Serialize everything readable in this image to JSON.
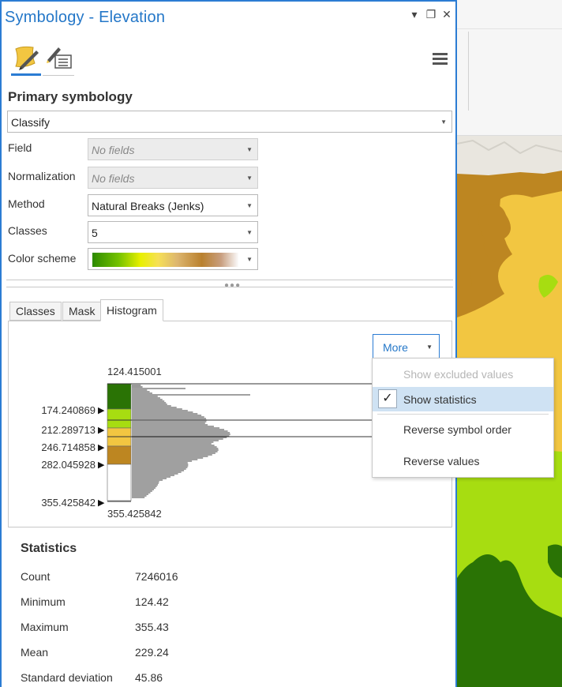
{
  "window": {
    "title": "Symbology - Elevation",
    "controls": [
      "▾",
      "❐",
      "✕"
    ]
  },
  "toolbar": {
    "tabs": [
      {
        "icon": "primary-symbology-icon",
        "active": true
      },
      {
        "icon": "vary-symbology-icon",
        "active": false
      }
    ],
    "menu_icon": "hamburger-menu-icon"
  },
  "primary_symbology": {
    "heading": "Primary symbology",
    "renderer": "Classify",
    "field": {
      "label": "Field",
      "value": "No fields"
    },
    "normalization": {
      "label": "Normalization",
      "value": "No fields"
    },
    "method": {
      "label": "Method",
      "value": "Natural Breaks (Jenks)"
    },
    "classes": {
      "label": "Classes",
      "value": "5"
    },
    "color_scheme": {
      "label": "Color scheme",
      "colors": [
        "#2d8a00",
        "#74c200",
        "#e8f000",
        "#f6e055",
        "#ddb66e",
        "#b9802e",
        "#fbfbfb"
      ]
    }
  },
  "tabs": [
    {
      "label": "Classes",
      "active": false
    },
    {
      "label": "Mask",
      "active": false
    },
    {
      "label": "Histogram",
      "active": true
    }
  ],
  "histogram": {
    "more_button": "More",
    "min_label": "124.415001",
    "max_label": "355.425842",
    "breaks": [
      {
        "value": "174.240869",
        "color": "#a7dd11"
      },
      {
        "value": "212.289713",
        "color": "#f2c641"
      },
      {
        "value": "246.714858",
        "color": "#bd8621"
      },
      {
        "value": "282.045928",
        "color": "#ffffff"
      },
      {
        "value": "355.425842",
        "color": ""
      }
    ],
    "class_colors": [
      "#2a7305",
      "#a7dd11",
      "#f2c641",
      "#bd8621",
      "#ffffff"
    ]
  },
  "more_menu": {
    "items": [
      {
        "label": "Show excluded values",
        "disabled": true,
        "checked": false
      },
      {
        "label": "Show statistics",
        "disabled": false,
        "checked": true
      },
      {
        "label": "Reverse symbol order",
        "disabled": false,
        "checked": false
      },
      {
        "label": "Reverse values",
        "disabled": false,
        "checked": false
      }
    ]
  },
  "statistics": {
    "heading": "Statistics",
    "rows": [
      {
        "label": "Count",
        "value": "7246016"
      },
      {
        "label": "Minimum",
        "value": "124.42"
      },
      {
        "label": "Maximum",
        "value": "355.43"
      },
      {
        "label": "Mean",
        "value": "229.24"
      },
      {
        "label": "Standard deviation",
        "value": "45.86"
      }
    ]
  },
  "map": {
    "colors": {
      "dark_green": "#2a7305",
      "light_green": "#a7dd11",
      "yellow": "#f2c641",
      "brown": "#bd8621",
      "terrain": "#e9e6df"
    }
  }
}
